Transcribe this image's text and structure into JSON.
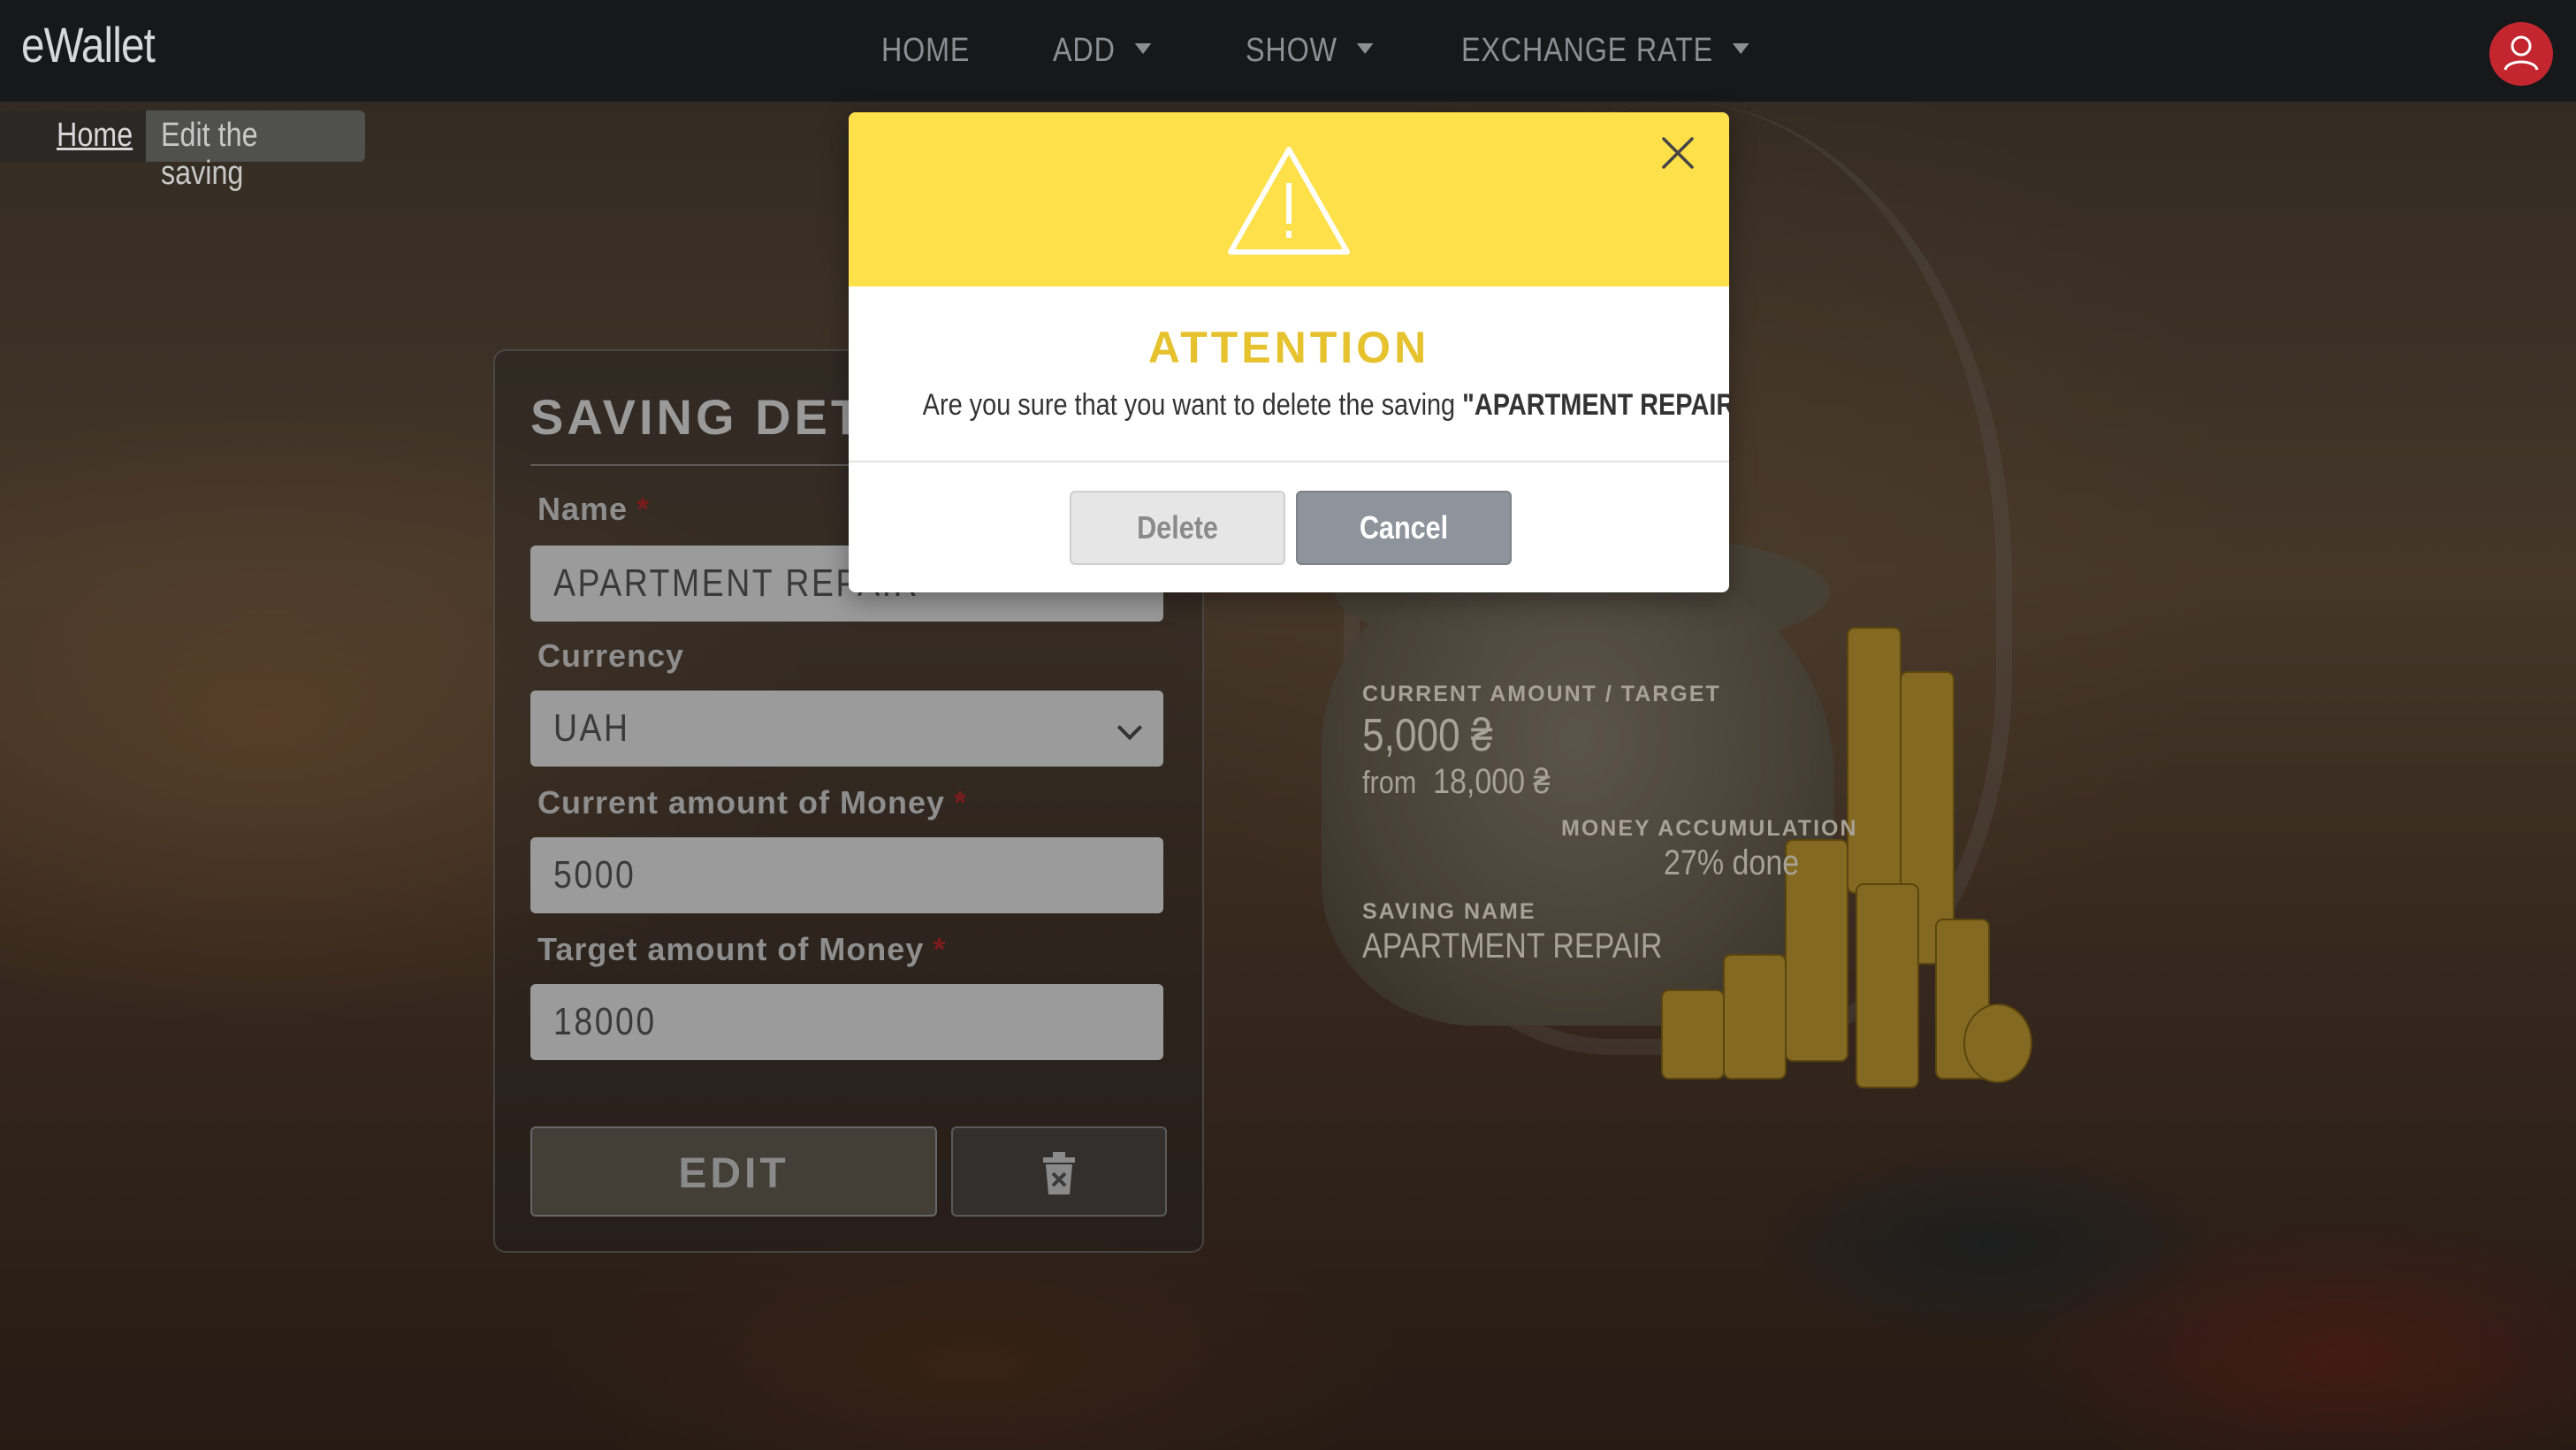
{
  "app": {
    "brand": "eWallet"
  },
  "nav": {
    "items": [
      {
        "label": "HOME"
      },
      {
        "label": "ADD"
      },
      {
        "label": "SHOW"
      },
      {
        "label": "EXCHANGE RATE"
      }
    ]
  },
  "breadcrumb": {
    "home": "Home",
    "current": "Edit the saving"
  },
  "form": {
    "title": "SAVING DET",
    "name_label": "Name",
    "name_value": "APARTMENT REPAIR",
    "currency_label": "Currency",
    "currency_value": "UAH",
    "current_label": "Current amount of Money",
    "current_value": "5000",
    "target_label": "Target amount of Money",
    "target_value": "18000",
    "required_mark": "*",
    "edit_label": "EDIT"
  },
  "summary": {
    "current_target_label": "CURRENT AMOUNT / TARGET",
    "current_amount": "5,000 ₴",
    "from_label": "from",
    "target_amount": "18,000 ₴",
    "accumulation_label": "MONEY ACCUMULATION",
    "accumulation_value": "27% done",
    "saving_name_label": "SAVING NAME",
    "saving_name_value": "APARTMENT REPAIR"
  },
  "modal": {
    "title": "ATTENTION",
    "message_prefix": "Are you sure that you want to delete the saving ",
    "message_name": "\"APARTMENT REPAIR\"",
    "message_suffix": "?",
    "delete_label": "Delete",
    "cancel_label": "Cancel"
  },
  "colors": {
    "accent_yellow": "#fee04a",
    "title_yellow": "#e6c22f",
    "avatar_red": "#c4262f",
    "navbar": "#16181a"
  }
}
